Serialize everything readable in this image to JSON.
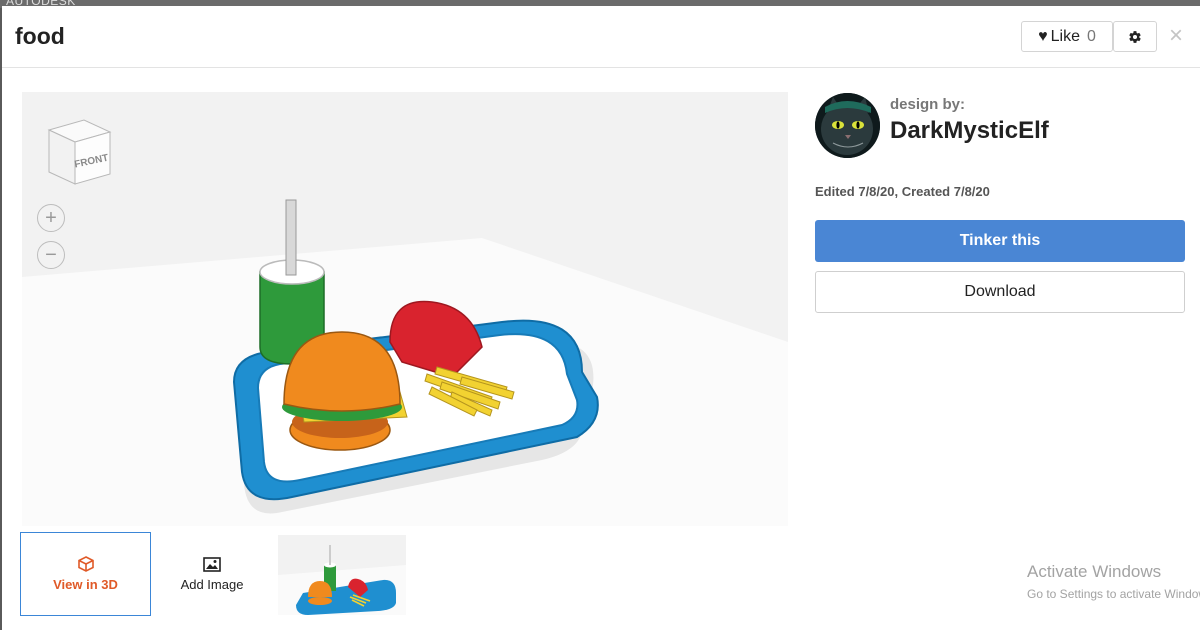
{
  "backdrop": {
    "text": "AUTODESK"
  },
  "header": {
    "title": "food",
    "like_label": "Like",
    "like_count": "0",
    "close_symbol": "×"
  },
  "viewer": {
    "viewcube_label": "FRONT",
    "zoom_in": "+",
    "zoom_out": "−"
  },
  "thumbnails": {
    "view3d_label": "View in 3D",
    "add_image_label": "Add Image"
  },
  "designer": {
    "design_by_label": "design by:",
    "username": "DarkMysticElf"
  },
  "dates": "Edited 7/8/20, Created 7/8/20",
  "actions": {
    "tinker_label": "Tinker this",
    "download_label": "Download"
  },
  "watermark": {
    "line1": "Activate Windows",
    "line2": "Go to Settings to activate Windows."
  },
  "colors": {
    "primary_button": "#4a86d4",
    "view3d_accent": "#e05a28",
    "tray": "#1f8fd0",
    "cup": "#2e9a3b",
    "bun": "#f08a1e",
    "fries_box": "#d9232e",
    "fries": "#f2d231"
  }
}
